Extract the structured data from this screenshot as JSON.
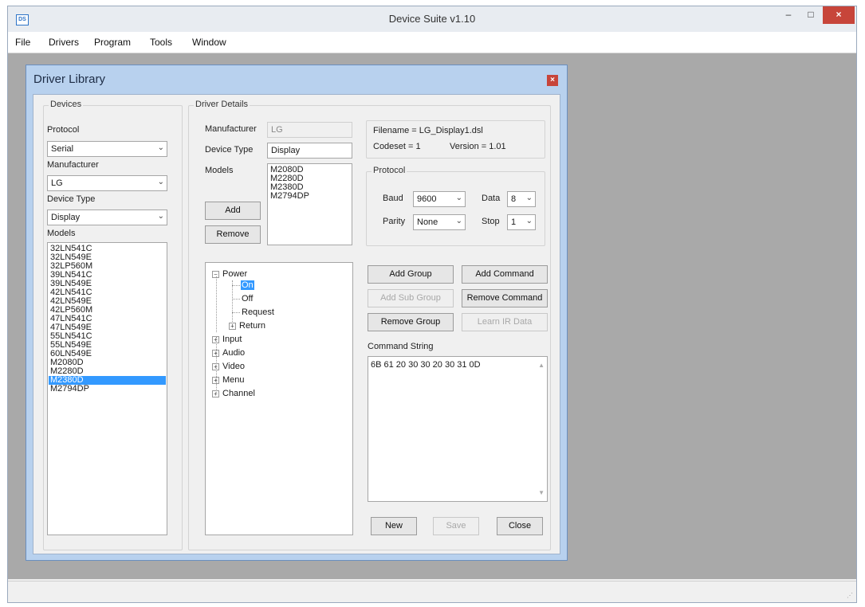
{
  "app": {
    "title": "Device Suite v1.10",
    "logo": "DS"
  },
  "window_controls": {
    "minimize": "‒",
    "maximize": "□",
    "close": "×"
  },
  "menu": [
    "File",
    "Drivers",
    "Program",
    "Tools",
    "Window"
  ],
  "dialog": {
    "title": "Driver Library",
    "close": "×",
    "devices": {
      "legend": "Devices",
      "protocol_label": "Protocol",
      "protocol_value": "Serial",
      "manufacturer_label": "Manufacturer",
      "manufacturer_value": "LG",
      "device_type_label": "Device Type",
      "device_type_value": "Display",
      "models_label": "Models",
      "models": [
        "32LN541C",
        "32LN549E",
        "32LP560M",
        "39LN541C",
        "39LN549E",
        "42LN541C",
        "42LN549E",
        "42LP560M",
        "47LN541C",
        "47LN549E",
        "55LN541C",
        "55LN549E",
        "60LN549E",
        "M2080D",
        "M2280D",
        "M2380D",
        "M2794DP"
      ],
      "selected_model": "M2380D"
    },
    "details": {
      "legend": "Driver Details",
      "manufacturer_label": "Manufacturer",
      "manufacturer_value": "LG",
      "device_type_label": "Device Type",
      "device_type_value": "Display",
      "models_label": "Models",
      "models": [
        "M2080D",
        "M2280D",
        "M2380D",
        "M2794DP"
      ],
      "add_button": "Add",
      "remove_button": "Remove"
    },
    "file_info": {
      "filename": "Filename = LG_Display1.dsl",
      "codeset": "Codeset = 1",
      "version": "Version = 1.01"
    },
    "protocol": {
      "legend": "Protocol",
      "baud_label": "Baud",
      "baud_value": "9600",
      "data_label": "Data",
      "data_value": "8",
      "parity_label": "Parity",
      "parity_value": "None",
      "stop_label": "Stop",
      "stop_value": "1"
    },
    "tree": {
      "power": "Power",
      "on": "On",
      "off": "Off",
      "request": "Request",
      "return": "Return",
      "input": "Input",
      "audio": "Audio",
      "video": "Video",
      "menu": "Menu",
      "channel": "Channel",
      "expanded_glyph": "−",
      "collapsed_glyph": "+"
    },
    "buttons": {
      "add_group": "Add Group",
      "add_command": "Add Command",
      "add_sub_group": "Add Sub Group",
      "remove_command": "Remove Command",
      "remove_group": "Remove Group",
      "learn_ir": "Learn IR Data",
      "new": "New",
      "save": "Save",
      "close": "Close"
    },
    "command": {
      "label": "Command String",
      "value": "6B 61 20 30 30 20 30 31 0D"
    }
  },
  "icons": {
    "dropdown": "⌄",
    "scroll_up": "▲",
    "scroll_down": "▼",
    "grip": "⋰"
  },
  "colors": {
    "selection": "#3399ff",
    "close_red": "#c7453a",
    "workspace": "#a9a9a9",
    "dialog_frame": "#b8d1ee"
  }
}
